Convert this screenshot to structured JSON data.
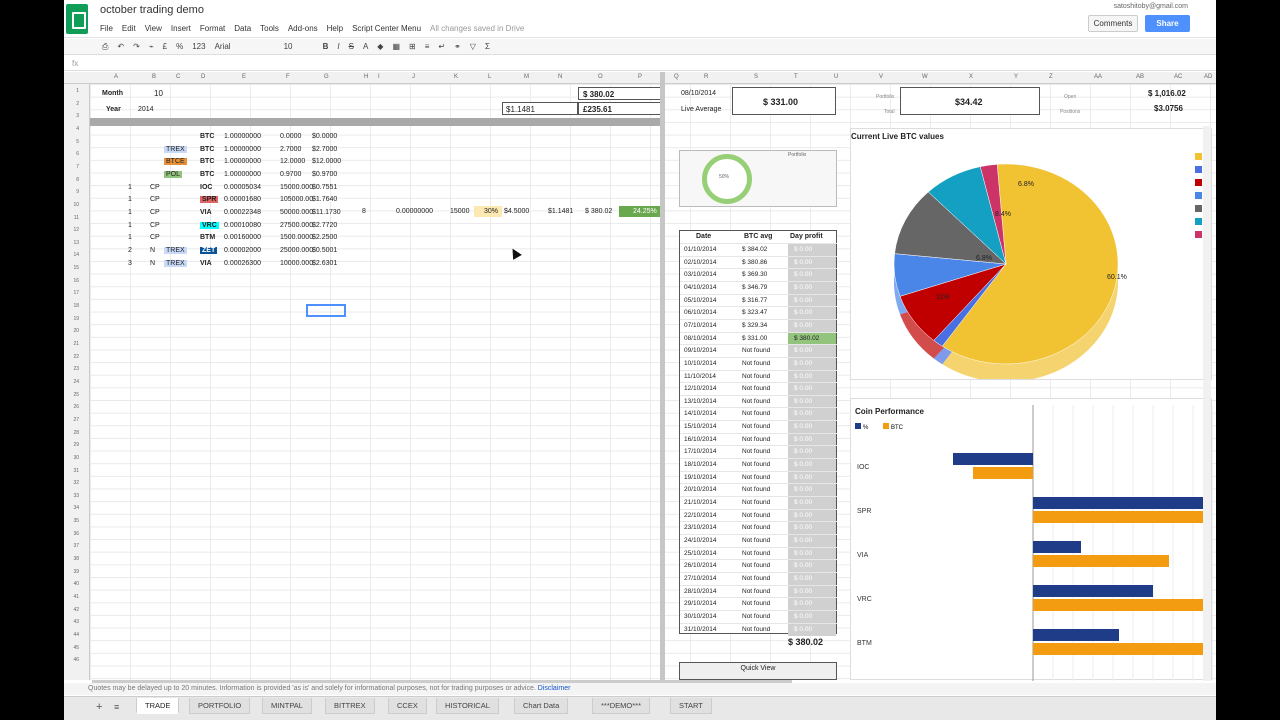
{
  "doc": {
    "title": "october trading demo",
    "user": "satoshitoby@gmail.com",
    "saved": "All changes saved in Drive",
    "comments": "Comments",
    "share": "Share"
  },
  "menu": [
    "File",
    "Edit",
    "View",
    "Insert",
    "Format",
    "Data",
    "Tools",
    "Add-ons",
    "Help",
    "Script Center Menu"
  ],
  "toolbar": {
    "font": "Arial",
    "size": "10",
    "fmt123": "123",
    "percent": "%",
    "currency": "£"
  },
  "columns": [
    "A",
    "B",
    "C",
    "D",
    "E",
    "F",
    "G",
    "H",
    "I",
    "J",
    "K",
    "L",
    "M",
    "N",
    "O",
    "P",
    "Q",
    "R",
    "S",
    "T",
    "U",
    "V",
    "W",
    "X",
    "Y",
    "Z",
    "AA",
    "AB",
    "AC",
    "AD",
    "AE"
  ],
  "rows": [
    "1",
    "2",
    "3",
    "4",
    "5",
    "6",
    "7",
    "8",
    "9",
    "10",
    "11",
    "12",
    "13",
    "14",
    "15",
    "16",
    "17",
    "18",
    "19",
    "20",
    "21",
    "22",
    "23",
    "24",
    "25",
    "26",
    "27",
    "28",
    "29",
    "30",
    "31",
    "32",
    "33",
    "34",
    "35",
    "36",
    "37",
    "38",
    "39",
    "40",
    "41",
    "42",
    "43",
    "44",
    "45",
    "46"
  ],
  "topleft": {
    "month_label": "Month",
    "month": "10",
    "year_label": "Year",
    "year": "2014"
  },
  "totals": {
    "btc_top": "$ 380.02",
    "btc_mid": "$1.1481",
    "gbp": "£235.61",
    "date": "08/10/2014",
    "live_average_label": "Live Average",
    "live_average": "$ 331.00",
    "portfolio": "$34.42",
    "open": "$ 1,016.02",
    "positions": "$3.0756",
    "open_label": "Open",
    "positions_label": "Positions",
    "portfolio_label": "Portfolio",
    "total_label": "Total"
  },
  "trades": [
    {
      "d": "BTC",
      "e": "1.00000000",
      "f": "0.0000",
      "g": "$0.0000"
    },
    {
      "c": "TREX",
      "d": "BTC",
      "e": "1.00000000",
      "f": "2.7000",
      "g": "$2.7000"
    },
    {
      "c": "BTCE",
      "d": "BTC",
      "e": "1.00000000",
      "f": "12.0000",
      "g": "$12.0000"
    },
    {
      "c": "POL",
      "d": "BTC",
      "e": "1.00000000",
      "f": "0.9700",
      "g": "$0.9700"
    },
    {
      "a": "1",
      "b": "CP",
      "d": "IOC",
      "e": "0.00005034",
      "f": "15000.000",
      "g": "$0.7551"
    },
    {
      "a": "1",
      "b": "CP",
      "d": "SPR",
      "e": "0.00001680",
      "f": "105000.00",
      "g": "$1.7640"
    },
    {
      "a": "1",
      "b": "CP",
      "d": "VIA",
      "e": "0.00022348",
      "f": "50000.000",
      "g": "$11.1730"
    },
    {
      "a": "1",
      "b": "CP",
      "d": "VRC",
      "e": "0.00010080",
      "f": "27500.000",
      "g": "$2.7720"
    },
    {
      "a": "1",
      "b": "CP",
      "d": "BTM",
      "e": "0.00160000",
      "f": "1500.0000",
      "g": "$2.2500"
    },
    {
      "a": "2",
      "b": "N",
      "c": "TREX",
      "d": "ZET",
      "e": "0.00002000",
      "f": "25000.000",
      "g": "$0.5001"
    },
    {
      "a": "3",
      "b": "N",
      "c": "TREX",
      "d": "VIA",
      "e": "0.00026300",
      "f": "10000.000",
      "g": "$2.6301"
    }
  ],
  "via_row": {
    "j": "8",
    "k": "0.00000000",
    "l": "15000",
    "m": "30%",
    "n": "$4.5000",
    "o": "$1.1481",
    "p": "$ 380.02",
    "q": "24.25%"
  },
  "gauge": {
    "value": "50%",
    "legend": "Portfolio"
  },
  "daytable": {
    "headers": [
      "Date",
      "BTC avg",
      "Day profit"
    ],
    "rows": [
      [
        "01/10/2014",
        "$ 384.02",
        "$ 0.00"
      ],
      [
        "02/10/2014",
        "$ 380.86",
        "$ 0.00"
      ],
      [
        "03/10/2014",
        "$ 369.30",
        "$ 0.00"
      ],
      [
        "04/10/2014",
        "$ 346.79",
        "$ 0.00"
      ],
      [
        "05/10/2014",
        "$ 316.77",
        "$ 0.00"
      ],
      [
        "06/10/2014",
        "$ 323.47",
        "$ 0.00"
      ],
      [
        "07/10/2014",
        "$ 329.34",
        "$ 0.00"
      ],
      [
        "08/10/2014",
        "$ 331.00",
        "$ 380.02"
      ],
      [
        "09/10/2014",
        "Not found",
        "$ 0.00"
      ],
      [
        "10/10/2014",
        "Not found",
        "$ 0.00"
      ],
      [
        "11/10/2014",
        "Not found",
        "$ 0.00"
      ],
      [
        "12/10/2014",
        "Not found",
        "$ 0.00"
      ],
      [
        "13/10/2014",
        "Not found",
        "$ 0.00"
      ],
      [
        "14/10/2014",
        "Not found",
        "$ 0.00"
      ],
      [
        "15/10/2014",
        "Not found",
        "$ 0.00"
      ],
      [
        "16/10/2014",
        "Not found",
        "$ 0.00"
      ],
      [
        "17/10/2014",
        "Not found",
        "$ 0.00"
      ],
      [
        "18/10/2014",
        "Not found",
        "$ 0.00"
      ],
      [
        "19/10/2014",
        "Not found",
        "$ 0.00"
      ],
      [
        "20/10/2014",
        "Not found",
        "$ 0.00"
      ],
      [
        "21/10/2014",
        "Not found",
        "$ 0.00"
      ],
      [
        "22/10/2014",
        "Not found",
        "$ 0.00"
      ],
      [
        "23/10/2014",
        "Not found",
        "$ 0.00"
      ],
      [
        "24/10/2014",
        "Not found",
        "$ 0.00"
      ],
      [
        "25/10/2014",
        "Not found",
        "$ 0.00"
      ],
      [
        "26/10/2014",
        "Not found",
        "$ 0.00"
      ],
      [
        "27/10/2014",
        "Not found",
        "$ 0.00"
      ],
      [
        "28/10/2014",
        "Not found",
        "$ 0.00"
      ],
      [
        "29/10/2014",
        "Not found",
        "$ 0.00"
      ],
      [
        "30/10/2014",
        "Not found",
        "$ 0.00"
      ],
      [
        "31/10/2014",
        "Not found",
        "$ 0.00"
      ]
    ],
    "total": "$ 380.02",
    "quick_view": "Quick View"
  },
  "chart_data": [
    {
      "type": "pie",
      "title": "Current Live BTC values",
      "labels": [
        "60.1%",
        "6.8%",
        "11%",
        "8.4%",
        "6.8%"
      ],
      "slices": [
        {
          "value": 60.1,
          "color": "#f1c232"
        },
        {
          "value": 1.5,
          "color": "#4a6fe3"
        },
        {
          "value": 8.5,
          "color": "#c00000"
        },
        {
          "value": 6.8,
          "color": "#4a86e8"
        },
        {
          "value": 11,
          "color": "#666666"
        },
        {
          "value": 8.4,
          "color": "#13a0c2"
        },
        {
          "value": 2.4,
          "color": "#cc3366"
        }
      ]
    },
    {
      "type": "bar",
      "title": "Coin Performance",
      "legend": [
        "%",
        "BTC"
      ],
      "colors": [
        "#1f3c88",
        "#f39c12"
      ],
      "categories": [
        "IOC",
        "SPR",
        "VIA",
        "VRC",
        "BTM"
      ],
      "series": [
        {
          "name": "%",
          "values": [
            -40,
            90,
            24,
            60,
            43
          ]
        },
        {
          "name": "BTC",
          "values": [
            -30,
            115,
            68,
            115,
            115
          ]
        }
      ]
    }
  ],
  "status": {
    "text": "Quotes may be delayed up to 20 minutes. Information is provided 'as is' and solely for informational purposes, not for trading purposes or advice.",
    "link": "Disclaimer"
  },
  "tabs": [
    "TRADE",
    "PORTFOLIO",
    "MINTPAL",
    "BITTREX",
    "CCEX",
    "HISTORICAL",
    "Chart Data",
    "***DEMO***",
    "START"
  ]
}
